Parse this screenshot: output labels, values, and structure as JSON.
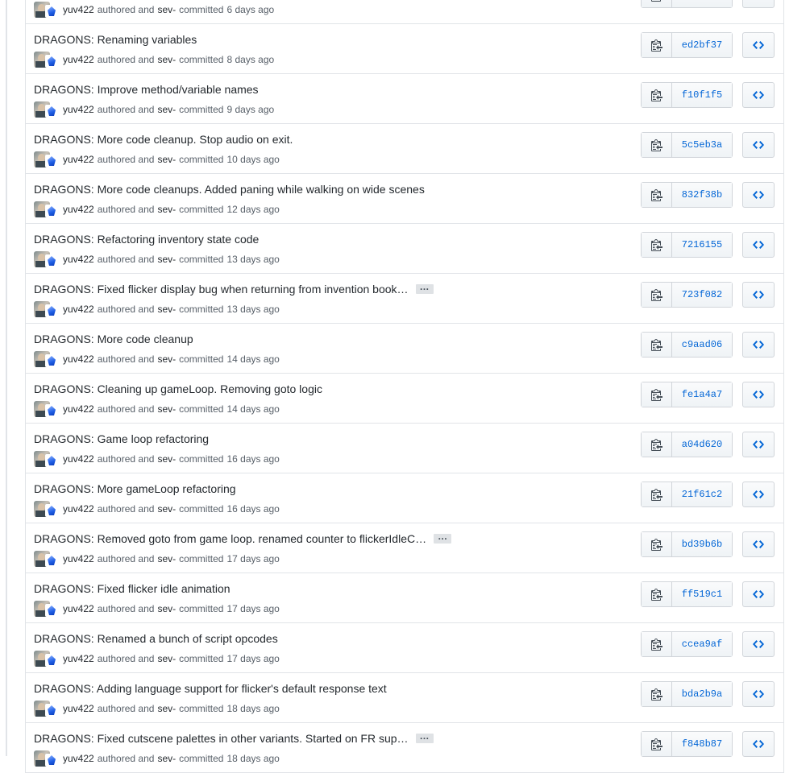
{
  "commits": [
    {
      "title": "",
      "author": "yuv422",
      "committer": "sev-",
      "authored_text": "authored and",
      "committed_text": "committed",
      "time": "6 days ago",
      "sha": "",
      "truncated": false
    },
    {
      "title": "DRAGONS: Renaming variables",
      "author": "yuv422",
      "committer": "sev-",
      "authored_text": "authored and",
      "committed_text": "committed",
      "time": "8 days ago",
      "sha": "ed2bf37",
      "truncated": false
    },
    {
      "title": "DRAGONS: Improve method/variable names",
      "author": "yuv422",
      "committer": "sev-",
      "authored_text": "authored and",
      "committed_text": "committed",
      "time": "9 days ago",
      "sha": "f10f1f5",
      "truncated": false
    },
    {
      "title": "DRAGONS: More code cleanup. Stop audio on exit.",
      "author": "yuv422",
      "committer": "sev-",
      "authored_text": "authored and",
      "committed_text": "committed",
      "time": "10 days ago",
      "sha": "5c5eb3a",
      "truncated": false
    },
    {
      "title": "DRAGONS: More code cleanups. Added paning while walking on wide scenes",
      "author": "yuv422",
      "committer": "sev-",
      "authored_text": "authored and",
      "committed_text": "committed",
      "time": "12 days ago",
      "sha": "832f38b",
      "truncated": false
    },
    {
      "title": "DRAGONS: Refactoring inventory state code",
      "author": "yuv422",
      "committer": "sev-",
      "authored_text": "authored and",
      "committed_text": "committed",
      "time": "13 days ago",
      "sha": "7216155",
      "truncated": false
    },
    {
      "title": "DRAGONS: Fixed flicker display bug when returning from invention book…",
      "author": "yuv422",
      "committer": "sev-",
      "authored_text": "authored and",
      "committed_text": "committed",
      "time": "13 days ago",
      "sha": "723f082",
      "truncated": true
    },
    {
      "title": "DRAGONS: More code cleanup",
      "author": "yuv422",
      "committer": "sev-",
      "authored_text": "authored and",
      "committed_text": "committed",
      "time": "14 days ago",
      "sha": "c9aad06",
      "truncated": false
    },
    {
      "title": "DRAGONS: Cleaning up gameLoop. Removing goto logic",
      "author": "yuv422",
      "committer": "sev-",
      "authored_text": "authored and",
      "committed_text": "committed",
      "time": "14 days ago",
      "sha": "fe1a4a7",
      "truncated": false
    },
    {
      "title": "DRAGONS: Game loop refactoring",
      "author": "yuv422",
      "committer": "sev-",
      "authored_text": "authored and",
      "committed_text": "committed",
      "time": "16 days ago",
      "sha": "a04d620",
      "truncated": false
    },
    {
      "title": "DRAGONS: More gameLoop refactoring",
      "author": "yuv422",
      "committer": "sev-",
      "authored_text": "authored and",
      "committed_text": "committed",
      "time": "16 days ago",
      "sha": "21f61c2",
      "truncated": false
    },
    {
      "title": "DRAGONS: Removed goto from game loop. renamed counter to flickerIdleC…",
      "author": "yuv422",
      "committer": "sev-",
      "authored_text": "authored and",
      "committed_text": "committed",
      "time": "17 days ago",
      "sha": "bd39b6b",
      "truncated": true
    },
    {
      "title": "DRAGONS: Fixed flicker idle animation",
      "author": "yuv422",
      "committer": "sev-",
      "authored_text": "authored and",
      "committed_text": "committed",
      "time": "17 days ago",
      "sha": "ff519c1",
      "truncated": false
    },
    {
      "title": "DRAGONS: Renamed a bunch of script opcodes",
      "author": "yuv422",
      "committer": "sev-",
      "authored_text": "authored and",
      "committed_text": "committed",
      "time": "17 days ago",
      "sha": "ccea9af",
      "truncated": false
    },
    {
      "title": "DRAGONS: Adding language support for flicker's default response text",
      "author": "yuv422",
      "committer": "sev-",
      "authored_text": "authored and",
      "committed_text": "committed",
      "time": "18 days ago",
      "sha": "bda2b9a",
      "truncated": false
    },
    {
      "title": "DRAGONS: Fixed cutscene palettes in other variants. Started on FR sup…",
      "author": "yuv422",
      "committer": "sev-",
      "authored_text": "authored and",
      "committed_text": "committed",
      "time": "18 days ago",
      "sha": "f848b87",
      "truncated": true
    }
  ],
  "ellipsis_label": "…",
  "icons": {
    "copy": "clipboard-icon",
    "browse": "code-icon"
  },
  "colors": {
    "sha_link": "#0366d6",
    "border": "#e1e4e8",
    "text": "#24292e",
    "muted": "#586069"
  }
}
